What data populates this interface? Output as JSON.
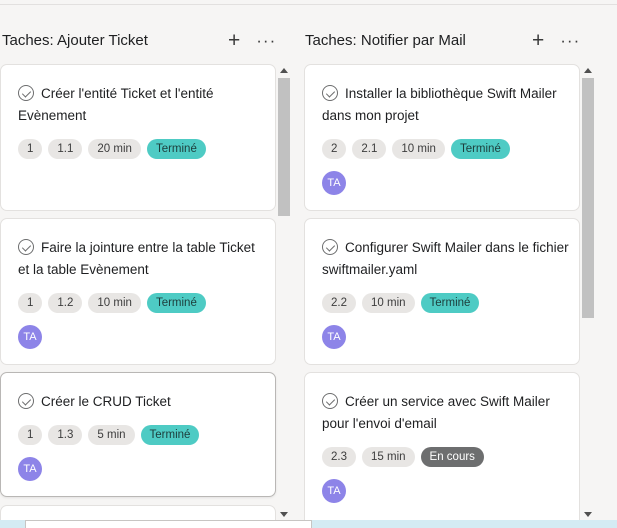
{
  "columns": [
    {
      "title": "Taches: Ajouter Ticket",
      "add_icon": "+",
      "more_icon": "···",
      "cards": [
        {
          "title": "Créer l'entité Ticket et l'entité Evènement",
          "tags": [
            "1",
            "1.1",
            "20 min"
          ],
          "status": "Terminé",
          "avatar": null
        },
        {
          "title": "Faire la jointure entre la table Ticket et la table Evènement",
          "tags": [
            "1",
            "1.2",
            "10 min"
          ],
          "status": "Terminé",
          "avatar": "TA"
        },
        {
          "title": "Créer le CRUD Ticket",
          "tags": [
            "1",
            "1.3",
            "5 min"
          ],
          "status": "Terminé",
          "avatar": "TA"
        }
      ]
    },
    {
      "title": "Taches: Notifier par Mail",
      "add_icon": "+",
      "more_icon": "···",
      "cards": [
        {
          "title": "Installer la bibliothèque Swift Mailer dans mon projet",
          "tags": [
            "2",
            "2.1",
            "10 min"
          ],
          "status": "Terminé",
          "avatar": "TA"
        },
        {
          "title": "Configurer Swift Mailer dans le fichier swiftmailer.yaml",
          "tags": [
            "2.2",
            "10 min"
          ],
          "status": "Terminé",
          "avatar": "TA"
        },
        {
          "title": "Créer un service avec Swift Mailer pour l'envoi d'email",
          "tags": [
            "2.3",
            "15 min"
          ],
          "status": "En cours",
          "avatar": "TA"
        }
      ]
    }
  ],
  "colors": {
    "done": "#4ecbc4",
    "in_progress": "#6d6e6f",
    "avatar": "#8d84e8"
  }
}
